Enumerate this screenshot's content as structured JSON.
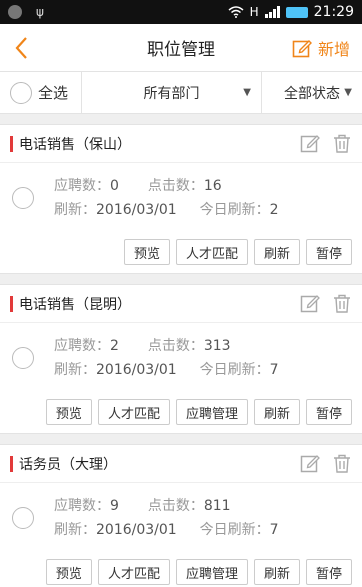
{
  "status": {
    "time": "21:29"
  },
  "header": {
    "title": "职位管理",
    "add_label": "新增"
  },
  "filter": {
    "select_all": "全选",
    "department": "所有部门",
    "state": "全部状态"
  },
  "labels": {
    "applicants": "应聘数：",
    "clicks": "点击数：",
    "refreshed": "刷新：",
    "today_refresh": "今日刷新："
  },
  "jobs": [
    {
      "name": "电话销售（保山）",
      "applicants": "0",
      "clicks": "16",
      "date": "2016/03/01",
      "today": "2"
    },
    {
      "name": "电话销售（昆明）",
      "applicants": "2",
      "clicks": "313",
      "date": "2016/03/01",
      "today": "7"
    },
    {
      "name": "话务员（大理）",
      "applicants": "9",
      "clicks": "811",
      "date": "2016/03/01",
      "today": "7"
    }
  ],
  "buttons": {
    "preview": "预览",
    "match": "人才匹配",
    "manage": "应聘管理",
    "refresh": "刷新",
    "pause": "暂停"
  },
  "colors": {
    "accent": "#f08519",
    "marker": "#e23a3a"
  }
}
